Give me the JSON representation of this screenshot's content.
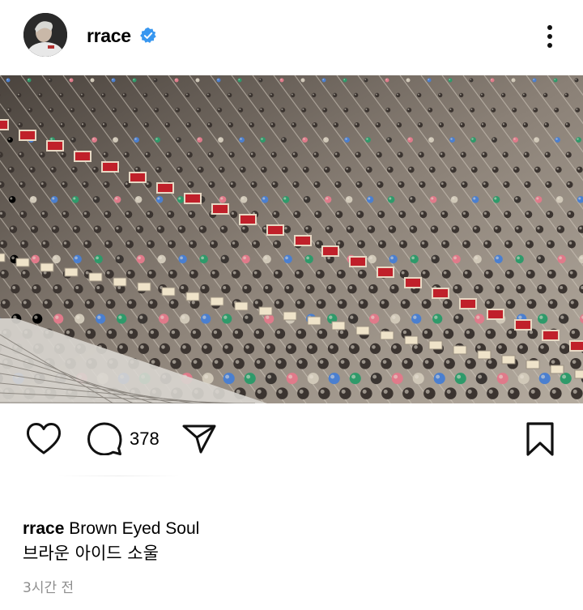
{
  "post": {
    "username": "rrace",
    "verified": true,
    "image_description_icon": "mixing-console-photo",
    "comment_count": "378",
    "caption_user": "rrace",
    "caption_text": "Brown Eyed Soul",
    "caption_text_korean": "브라운 아이드 소울",
    "timestamp": "3시간 전"
  },
  "icons": {
    "verified": "verified-badge-icon",
    "more": "more-vertical-icon",
    "like": "heart-icon",
    "comment": "comment-icon",
    "share": "send-icon",
    "save": "bookmark-icon"
  },
  "colors": {
    "verified_blue": "#3897f0",
    "text_primary": "#000000",
    "text_secondary": "#8e8e8e",
    "background": "#ffffff"
  }
}
